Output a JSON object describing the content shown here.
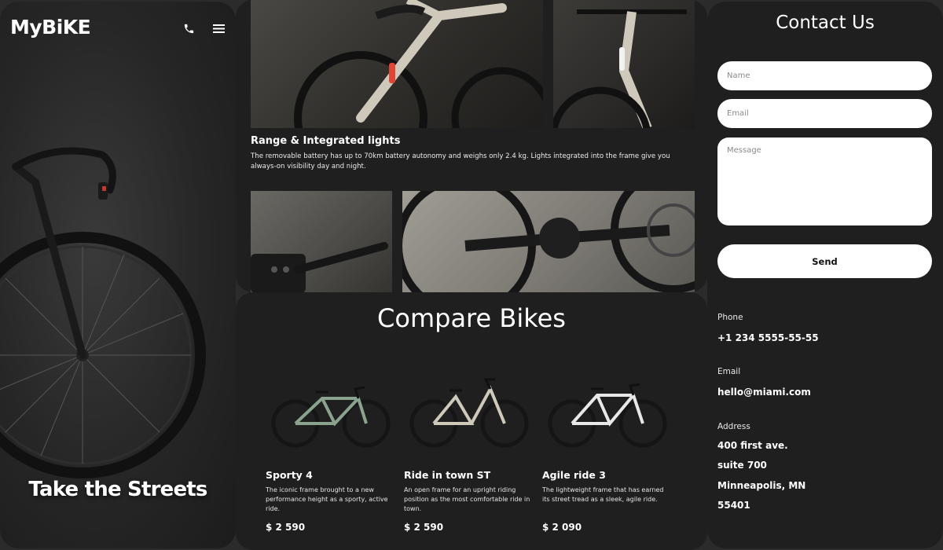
{
  "brand": {
    "logo": "MyBiKE"
  },
  "hero": {
    "title": "Take the Streets",
    "icons": [
      "phone-icon",
      "menu-icon"
    ]
  },
  "features": {
    "title": "Range & Integrated lights",
    "text": "The removable battery has up to 70km battery autonomy and weighs only 2.4 kg. Lights integrated into the frame give you always-on visibility day and night."
  },
  "compare": {
    "title": "Compare Bikes",
    "bikes": [
      {
        "name": "Sporty 4",
        "desc": "The iconic frame brought to a new performance height as a sporty, active ride.",
        "price": "$ 2 590",
        "frame_color": "#8aa38f"
      },
      {
        "name": "Ride in town ST",
        "desc": "An open frame for an upright riding position as the most comfortable ride in town.",
        "price": "$ 2 590",
        "frame_color": "#cfc9bb"
      },
      {
        "name": "Agile ride 3",
        "desc": "The lightweight frame that has earned its street tread as a sleek, agile ride.",
        "price": "$ 2 090",
        "frame_color": "#e8e8e8"
      }
    ]
  },
  "contact": {
    "title": "Contact Us",
    "name_placeholder": "Name",
    "email_placeholder": "Email",
    "message_placeholder": "Message",
    "send_label": "Send",
    "phone_label": "Phone",
    "phone_value": "+1 234 5555-55-55",
    "email_label": "Email",
    "email_value": "hello@miami.com",
    "address_label": "Address",
    "address_lines": [
      "400 first ave.",
      "suite 700",
      "Minneapolis, MN",
      "55401"
    ]
  }
}
